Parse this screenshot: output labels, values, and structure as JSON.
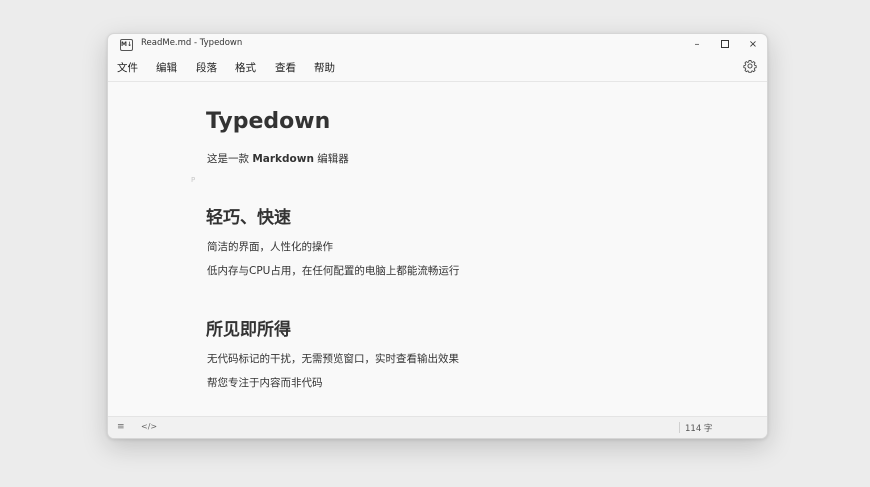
{
  "window": {
    "title": "ReadMe.md - Typedown",
    "icon_text": "M↓",
    "controls": {
      "minimize": "–",
      "maximize": "□",
      "close": "×"
    }
  },
  "menu": {
    "items": [
      "文件",
      "编辑",
      "段落",
      "格式",
      "查看",
      "帮助"
    ],
    "settings_icon": "gear-icon"
  },
  "document": {
    "title": "Typedown",
    "intro_prefix": "这是一款 ",
    "intro_bold": "Markdown",
    "intro_suffix": " 编辑器",
    "paragraph_marker": "P",
    "sections": [
      {
        "heading": "轻巧、快速",
        "lines": [
          "简洁的界面，人性化的操作",
          "低内存与CPU占用，在任何配置的电脑上都能流畅运行"
        ]
      },
      {
        "heading": "所见即所得",
        "lines": [
          "无代码标记的干扰，无需预览窗口，实时查看输出效果",
          "帮您专注于内容而非代码"
        ]
      }
    ]
  },
  "statusbar": {
    "menu_icon": "≡",
    "source_icon": "</>",
    "word_count": "114 字"
  }
}
